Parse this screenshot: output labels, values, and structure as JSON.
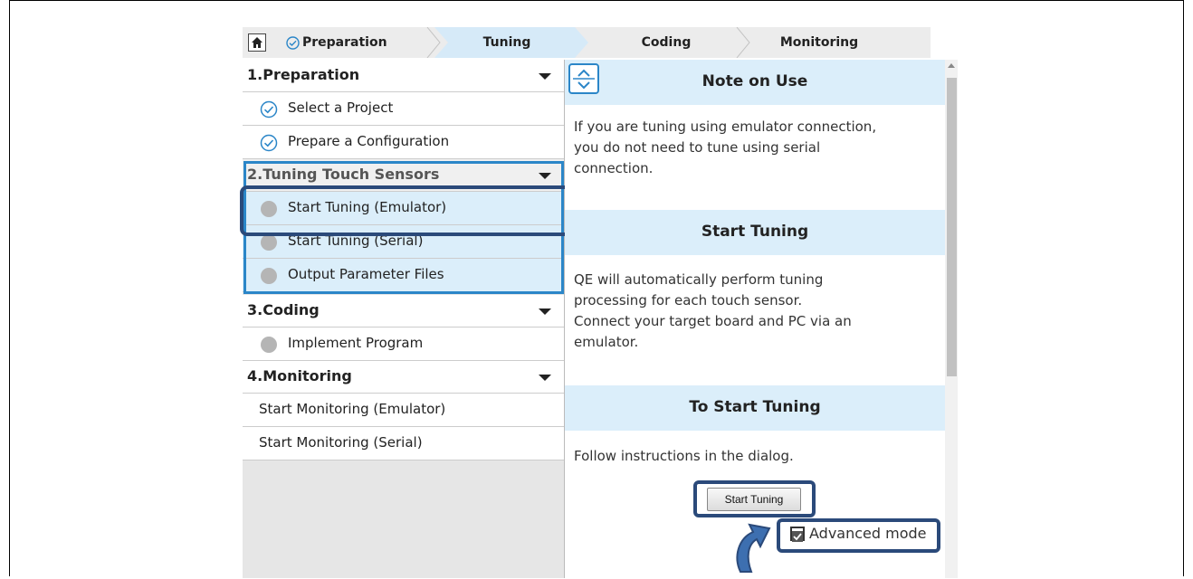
{
  "breadcrumb": {
    "steps": [
      {
        "label": "Preparation",
        "state": "done"
      },
      {
        "label": "Tuning",
        "state": "current"
      },
      {
        "label": "Coding",
        "state": "pending"
      },
      {
        "label": "Monitoring",
        "state": "pending"
      }
    ]
  },
  "sidebar": {
    "sections": [
      {
        "title": "1.Preparation",
        "items": [
          {
            "label": "Select a Project",
            "status": "done"
          },
          {
            "label": "Prepare a Configuration",
            "status": "done"
          }
        ]
      },
      {
        "title": "2.Tuning Touch Sensors",
        "items": [
          {
            "label": "Start Tuning (Emulator)",
            "status": "pending"
          },
          {
            "label": "Start Tuning (Serial)",
            "status": "pending"
          },
          {
            "label": "Output Parameter Files",
            "status": "pending"
          }
        ]
      },
      {
        "title": "3.Coding",
        "items": [
          {
            "label": "Implement Program",
            "status": "pending"
          }
        ]
      },
      {
        "title": "4.Monitoring",
        "items": [
          {
            "label": "Start Monitoring (Emulator)"
          },
          {
            "label": "Start Monitoring (Serial)"
          }
        ]
      }
    ]
  },
  "content": {
    "note_title": "Note on Use",
    "note_lines": [
      "If you are tuning using emulator connection,",
      "you do not need to tune using serial",
      "connection."
    ],
    "start_title": "Start Tuning",
    "start_lines": [
      "QE will automatically perform tuning",
      "processing for each touch sensor.",
      "Connect your target board and PC via an",
      "emulator."
    ],
    "to_start_title": "To Start Tuning",
    "to_start_text": "Follow instructions in the dialog.",
    "start_button": "Start Tuning",
    "advanced_label": "Advanced mode",
    "advanced_checked": true
  },
  "colors": {
    "band": "#dbeefa",
    "highlight": "#2b86c8",
    "callout": "#2b4a7a",
    "check": "#2b86c8"
  }
}
